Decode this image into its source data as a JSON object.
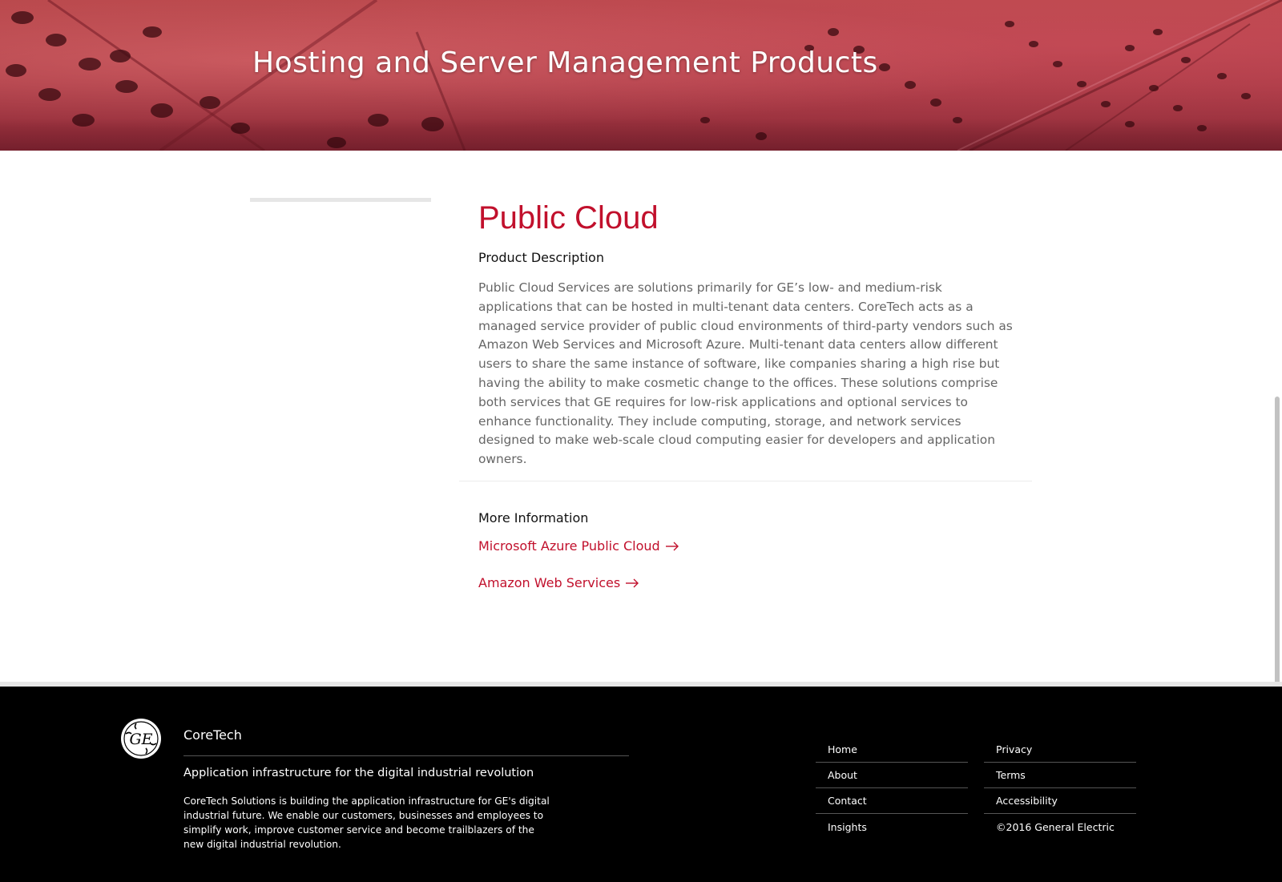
{
  "hero": {
    "title": "Hosting and Server Management Products"
  },
  "main": {
    "product_title": "Public Cloud",
    "description_heading": "Product Description",
    "description": "Public Cloud Services are solutions primarily for GE’s low- and medium-risk applications that can be hosted in multi-tenant data centers. CoreTech acts as a managed service provider of public cloud environments of third-party vendors such as Amazon Web Services and Microsoft Azure. Multi-tenant data centers allow different users to share the same instance of software, like companies sharing a high rise but having the ability to make cosmetic change to the offices. These solutions comprise both services that GE requires for low-risk applications and optional services to enhance functionality. They include computing, storage, and network services designed to make web-scale cloud computing easier for developers and application owners.",
    "more_heading": "More Information",
    "links": [
      {
        "label": "Microsoft Azure Public Cloud",
        "icon": "arrow-right-icon"
      },
      {
        "label": "Amazon Web Services",
        "icon": "arrow-right-icon"
      }
    ]
  },
  "footer": {
    "logo_text": "GE",
    "brand": "CoreTech",
    "tagline": "Application infrastructure for the digital industrial revolution",
    "about": "CoreTech Solutions is building the application infrastructure for GE's digital industrial future. We enable our customers, businesses and employees to simplify work, improve customer service and become trailblazers of the new digital industrial revolution.",
    "col1": [
      "Home",
      "About",
      "Contact",
      "Insights"
    ],
    "col2": [
      "Privacy",
      "Terms",
      "Accessibility",
      "©2016 General Electric"
    ]
  },
  "colors": {
    "accent": "#c1102c",
    "footer_bg": "#000000",
    "hero_red": "#a83a44"
  }
}
